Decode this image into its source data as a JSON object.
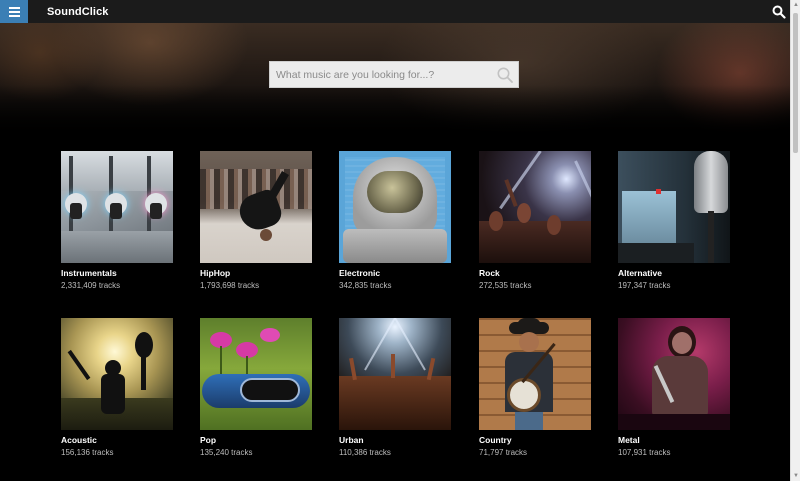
{
  "header": {
    "brand": "SoundClick",
    "menu_icon": "hamburger-menu-icon",
    "search_icon": "search-icon",
    "accent": "#3b7fb5"
  },
  "hero": {
    "search_placeholder": "What music are you looking for...?"
  },
  "genres": [
    {
      "title": "Instrumentals",
      "count": "2,331,409 tracks",
      "image": "mixing-console-faders"
    },
    {
      "title": "HipHop",
      "count": "1,793,698 tracks",
      "image": "breakdancer-crowd"
    },
    {
      "title": "Electronic",
      "count": "342,835 tracks",
      "image": "astronaut-helmet"
    },
    {
      "title": "Rock",
      "count": "272,535 tracks",
      "image": "concert-crowd"
    },
    {
      "title": "Alternative",
      "count": "197,347 tracks",
      "image": "studio-microphone"
    },
    {
      "title": "Acoustic",
      "count": "156,136 tracks",
      "image": "guitar-silhouette-sunset"
    },
    {
      "title": "Pop",
      "count": "135,240 tracks",
      "image": "headphones-flowers"
    },
    {
      "title": "Urban",
      "count": "110,386 tracks",
      "image": "stage-lights-crowd"
    },
    {
      "title": "Country",
      "count": "71,797 tracks",
      "image": "banjo-player"
    },
    {
      "title": "Metal",
      "count": "107,931 tracks",
      "image": "metal-singer"
    }
  ]
}
